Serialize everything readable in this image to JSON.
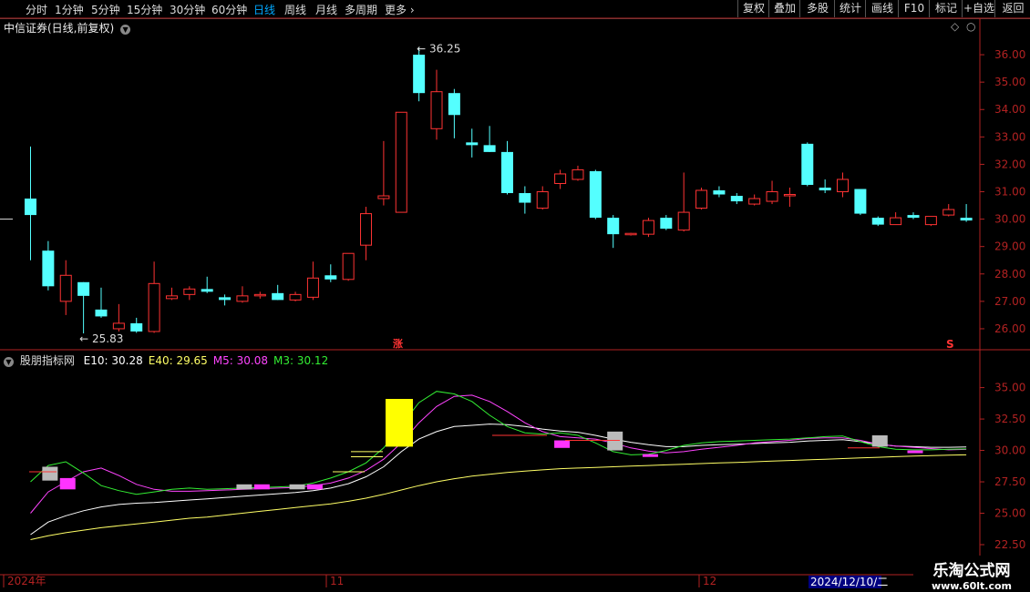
{
  "toolbar": {
    "periods": [
      "分时",
      "1分钟",
      "5分钟",
      "15分钟",
      "30分钟",
      "60分钟",
      "日线",
      "周线",
      "月线",
      "多周期",
      "更多"
    ],
    "active_period": "日线",
    "right_buttons": [
      "复权",
      "叠加",
      "多股",
      "统计",
      "画线",
      "F10",
      "标记",
      "+自选",
      "返回"
    ]
  },
  "stock": {
    "name": "中信证券(日线,前复权)"
  },
  "indicator": {
    "name": "股朋指标网",
    "values": [
      {
        "label": "E10",
        "value": "30.28",
        "color": "#ffffff"
      },
      {
        "label": "E40",
        "value": "29.65",
        "color": "#ffff66"
      },
      {
        "label": "M5",
        "value": "30.08",
        "color": "#ff44ff"
      },
      {
        "label": "M3",
        "value": "30.12",
        "color": "#33ee33"
      }
    ]
  },
  "main_axis": {
    "ticks": [
      "36.00",
      "35.00",
      "34.00",
      "33.00",
      "32.00",
      "31.00",
      "30.00",
      "29.00",
      "28.00",
      "27.00",
      "26.00"
    ]
  },
  "sub_axis": {
    "ticks": [
      "35.00",
      "32.50",
      "30.00",
      "27.50",
      "25.00",
      "22.50"
    ]
  },
  "annotations": {
    "high": "36.25",
    "low": "25.83",
    "limit_up_marker": "涨",
    "s_marker": "S"
  },
  "date_axis": {
    "labels": [
      "2024年",
      "11",
      "12"
    ],
    "cursor_date": "2024/12/10/二"
  },
  "watermark": {
    "line1": "乐淘公式网",
    "line2": "www.60lt.com"
  },
  "colors": {
    "up": "#ff3333",
    "down": "#54ffff",
    "axis": "#b22222",
    "bg": "#000000"
  },
  "chart_data": {
    "type": "candlestick",
    "ylim": [
      25.5,
      36.8
    ],
    "candles": [
      {
        "o": 30.75,
        "h": 32.65,
        "l": 28.5,
        "c": 30.15
      },
      {
        "o": 28.85,
        "h": 29.2,
        "l": 27.4,
        "c": 27.55
      },
      {
        "o": 27.0,
        "h": 28.5,
        "l": 26.5,
        "c": 27.95
      },
      {
        "o": 27.7,
        "h": 27.7,
        "l": 25.83,
        "c": 27.2
      },
      {
        "o": 26.7,
        "h": 27.5,
        "l": 26.4,
        "c": 26.45
      },
      {
        "o": 26.0,
        "h": 26.9,
        "l": 25.9,
        "c": 26.2
      },
      {
        "o": 26.2,
        "h": 26.4,
        "l": 25.85,
        "c": 25.9
      },
      {
        "o": 25.9,
        "h": 28.45,
        "l": 25.85,
        "c": 27.65
      },
      {
        "o": 27.1,
        "h": 27.5,
        "l": 27.05,
        "c": 27.2
      },
      {
        "o": 27.25,
        "h": 27.55,
        "l": 27.05,
        "c": 27.45
      },
      {
        "o": 27.45,
        "h": 27.9,
        "l": 27.3,
        "c": 27.35
      },
      {
        "o": 27.15,
        "h": 27.25,
        "l": 26.85,
        "c": 27.05
      },
      {
        "o": 27.0,
        "h": 27.55,
        "l": 26.95,
        "c": 27.2
      },
      {
        "o": 27.2,
        "h": 27.35,
        "l": 27.1,
        "c": 27.25
      },
      {
        "o": 27.3,
        "h": 27.6,
        "l": 27.05,
        "c": 27.05
      },
      {
        "o": 27.05,
        "h": 27.35,
        "l": 27.0,
        "c": 27.25
      },
      {
        "o": 27.15,
        "h": 28.45,
        "l": 27.05,
        "c": 27.85
      },
      {
        "o": 27.95,
        "h": 28.35,
        "l": 27.7,
        "c": 27.8
      },
      {
        "o": 27.8,
        "h": 28.75,
        "l": 27.75,
        "c": 28.75
      },
      {
        "o": 29.05,
        "h": 30.45,
        "l": 28.5,
        "c": 30.2
      },
      {
        "o": 30.75,
        "h": 32.85,
        "l": 30.5,
        "c": 30.85
      },
      {
        "o": 30.25,
        "h": 33.9,
        "l": 30.25,
        "c": 33.9
      },
      {
        "o": 36.0,
        "h": 36.25,
        "l": 34.3,
        "c": 34.6
      },
      {
        "o": 33.3,
        "h": 35.45,
        "l": 32.9,
        "c": 34.65
      },
      {
        "o": 34.6,
        "h": 34.75,
        "l": 32.95,
        "c": 33.8
      },
      {
        "o": 32.8,
        "h": 33.3,
        "l": 32.25,
        "c": 32.7
      },
      {
        "o": 32.7,
        "h": 33.4,
        "l": 32.45,
        "c": 32.45
      },
      {
        "o": 32.45,
        "h": 32.85,
        "l": 30.9,
        "c": 30.95
      },
      {
        "o": 30.95,
        "h": 31.2,
        "l": 30.2,
        "c": 30.6
      },
      {
        "o": 30.4,
        "h": 31.2,
        "l": 30.35,
        "c": 31.0
      },
      {
        "o": 31.3,
        "h": 31.8,
        "l": 31.1,
        "c": 31.65
      },
      {
        "o": 31.45,
        "h": 31.95,
        "l": 31.4,
        "c": 31.8
      },
      {
        "o": 31.75,
        "h": 31.8,
        "l": 30.0,
        "c": 30.05
      },
      {
        "o": 30.05,
        "h": 30.15,
        "l": 28.95,
        "c": 29.45
      },
      {
        "o": 29.45,
        "h": 29.5,
        "l": 29.4,
        "c": 29.48
      },
      {
        "o": 29.45,
        "h": 30.05,
        "l": 29.35,
        "c": 29.95
      },
      {
        "o": 30.05,
        "h": 30.15,
        "l": 29.6,
        "c": 29.65
      },
      {
        "o": 29.6,
        "h": 31.7,
        "l": 29.55,
        "c": 30.25
      },
      {
        "o": 30.4,
        "h": 31.15,
        "l": 30.35,
        "c": 31.05
      },
      {
        "o": 31.05,
        "h": 31.2,
        "l": 30.8,
        "c": 30.9
      },
      {
        "o": 30.85,
        "h": 30.95,
        "l": 30.55,
        "c": 30.65
      },
      {
        "o": 30.55,
        "h": 30.9,
        "l": 30.5,
        "c": 30.75
      },
      {
        "o": 30.65,
        "h": 31.4,
        "l": 30.55,
        "c": 31.0
      },
      {
        "o": 30.9,
        "h": 31.15,
        "l": 30.45,
        "c": 30.9
      },
      {
        "o": 32.75,
        "h": 32.8,
        "l": 31.2,
        "c": 31.25
      },
      {
        "o": 31.15,
        "h": 31.45,
        "l": 30.95,
        "c": 31.05
      },
      {
        "o": 31.0,
        "h": 31.7,
        "l": 30.8,
        "c": 31.45
      },
      {
        "o": 31.1,
        "h": 31.1,
        "l": 30.15,
        "c": 30.2
      },
      {
        "o": 30.05,
        "h": 30.1,
        "l": 29.75,
        "c": 29.8
      },
      {
        "o": 29.8,
        "h": 30.25,
        "l": 29.8,
        "c": 30.05
      },
      {
        "o": 30.15,
        "h": 30.25,
        "l": 30.0,
        "c": 30.05
      },
      {
        "o": 29.8,
        "h": 30.1,
        "l": 29.75,
        "c": 30.1
      },
      {
        "o": 30.15,
        "h": 30.55,
        "l": 30.1,
        "c": 30.35
      },
      {
        "o": 30.05,
        "h": 30.55,
        "l": 29.9,
        "c": 29.95
      }
    ],
    "indicator": {
      "ylim": [
        22.5,
        37.0
      ],
      "E10": [
        23.3,
        24.3,
        24.8,
        25.2,
        25.5,
        25.7,
        25.8,
        25.85,
        25.95,
        26.05,
        26.15,
        26.25,
        26.35,
        26.45,
        26.55,
        26.65,
        26.8,
        27.0,
        27.35,
        27.9,
        28.7,
        29.9,
        30.9,
        31.5,
        31.9,
        32.0,
        32.1,
        32.05,
        31.9,
        31.7,
        31.55,
        31.45,
        31.2,
        30.9,
        30.65,
        30.45,
        30.3,
        30.3,
        30.4,
        30.45,
        30.5,
        30.55,
        30.6,
        30.65,
        30.75,
        30.8,
        30.85,
        30.7,
        30.5,
        30.35,
        30.3,
        30.25,
        30.25,
        30.28
      ],
      "E40": [
        22.9,
        23.2,
        23.45,
        23.65,
        23.85,
        24.0,
        24.15,
        24.3,
        24.45,
        24.6,
        24.7,
        24.85,
        25.0,
        25.15,
        25.3,
        25.45,
        25.6,
        25.75,
        25.95,
        26.2,
        26.5,
        26.85,
        27.2,
        27.5,
        27.75,
        27.95,
        28.1,
        28.25,
        28.35,
        28.45,
        28.55,
        28.6,
        28.65,
        28.7,
        28.75,
        28.8,
        28.85,
        28.9,
        28.95,
        29.0,
        29.05,
        29.1,
        29.15,
        29.2,
        29.25,
        29.3,
        29.35,
        29.4,
        29.45,
        29.5,
        29.55,
        29.58,
        29.62,
        29.65
      ],
      "M5": [
        25.0,
        26.7,
        27.5,
        28.3,
        28.6,
        28.0,
        27.3,
        26.9,
        26.75,
        26.75,
        26.8,
        26.85,
        26.9,
        26.95,
        27.0,
        27.05,
        27.2,
        27.4,
        27.8,
        28.4,
        29.3,
        30.6,
        32.2,
        33.5,
        34.3,
        34.4,
        33.9,
        33.1,
        32.2,
        31.5,
        31.1,
        31.0,
        30.9,
        30.6,
        30.2,
        29.95,
        29.8,
        29.9,
        30.1,
        30.25,
        30.4,
        30.6,
        30.7,
        30.8,
        30.95,
        31.0,
        31.0,
        30.8,
        30.5,
        30.35,
        30.25,
        30.15,
        30.05,
        30.08
      ],
      "M3": [
        27.5,
        28.8,
        29.1,
        28.2,
        27.2,
        26.8,
        26.5,
        26.7,
        26.9,
        27.0,
        26.9,
        26.95,
        27.0,
        27.05,
        27.1,
        27.15,
        27.4,
        27.8,
        28.3,
        29.0,
        30.2,
        32.0,
        33.8,
        34.7,
        34.5,
        33.9,
        32.8,
        31.9,
        31.4,
        31.3,
        31.4,
        31.2,
        30.6,
        29.9,
        29.65,
        29.7,
        30.0,
        30.4,
        30.6,
        30.7,
        30.75,
        30.8,
        30.85,
        30.9,
        31.0,
        31.1,
        31.15,
        30.7,
        30.3,
        30.1,
        30.05,
        30.05,
        30.1,
        30.12
      ]
    }
  }
}
